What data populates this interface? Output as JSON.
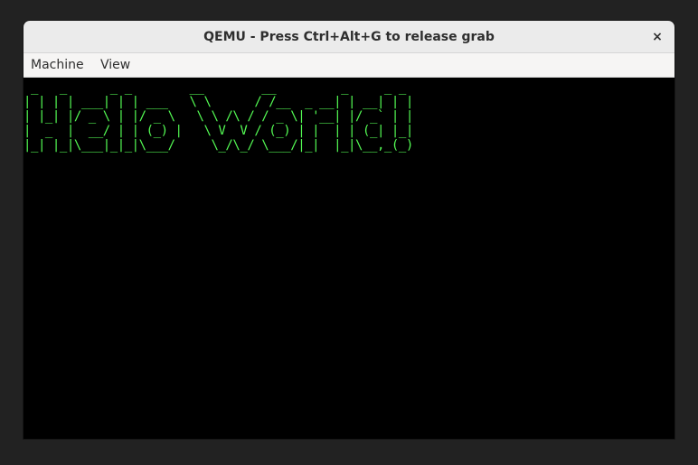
{
  "window": {
    "title": "QEMU - Press Ctrl+Alt+G to release grab",
    "close_glyph": "×"
  },
  "menubar": {
    "items": [
      {
        "label": "Machine"
      },
      {
        "label": "View"
      }
    ]
  },
  "screen": {
    "text_color": "#54fc54",
    "background": "#000000",
    "ascii_art": " _   _      _ _        __        __         _     _ _ \n| | | | ___| | | ___   \\ \\      / /__  _ __| | __| | |\n| |_| |/ _ \\ | |/ _ \\   \\ \\ /\\ / / _ \\| '__| |/ _` | |\n|  _  |  __/ | | (_) |   \\ V  V / (_) | |  | | (_| |_|\n|_| |_|\\___|_|_|\\___/     \\_/\\_/ \\___/|_|  |_|\\__,_(_)"
  }
}
